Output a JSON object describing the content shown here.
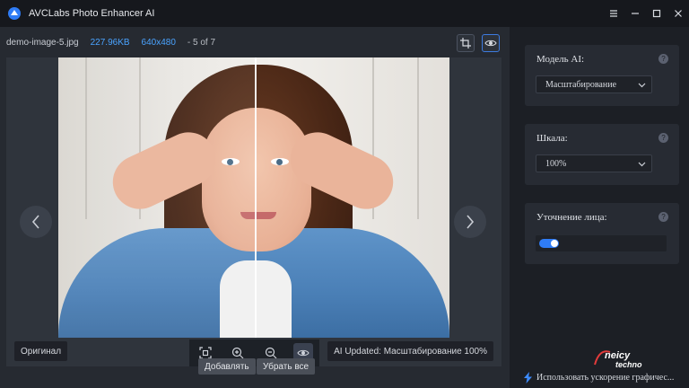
{
  "app": {
    "title": "AVCLabs Photo Enhancer AI"
  },
  "file": {
    "name": "demo-image-5.jpg",
    "size": "227.96KB",
    "dimensions": "640x480",
    "index": "- 5 of 7"
  },
  "viewer": {
    "original_tag": "Оригинал",
    "updated_tag": "AI Updated: Масштабирование 100%"
  },
  "actions": {
    "add_label": "Добавлять",
    "remove_all_label": "Убрать все"
  },
  "panel": {
    "model": {
      "label": "Модель AI:",
      "value": "Масштабирование"
    },
    "scale": {
      "label": "Шкала:",
      "value": "100%"
    },
    "face": {
      "label": "Уточнение лица:",
      "enabled": true
    },
    "gpu_label": "Использовать ускорение графичес..."
  },
  "watermark": {
    "text": "neicy techno"
  },
  "colors": {
    "accent": "#2f7cf6",
    "link": "#4aa3ff",
    "bg": "#1b1e24"
  },
  "icons": [
    "app-logo-icon",
    "menu-icon",
    "minimize-icon",
    "maximize-icon",
    "close-icon",
    "crop-icon",
    "eye-icon",
    "chevron-left-icon",
    "chevron-right-icon",
    "fit-screen-icon",
    "zoom-in-icon",
    "zoom-out-icon",
    "compare-eye-icon",
    "help-icon",
    "chevron-down-icon",
    "lightning-icon"
  ]
}
